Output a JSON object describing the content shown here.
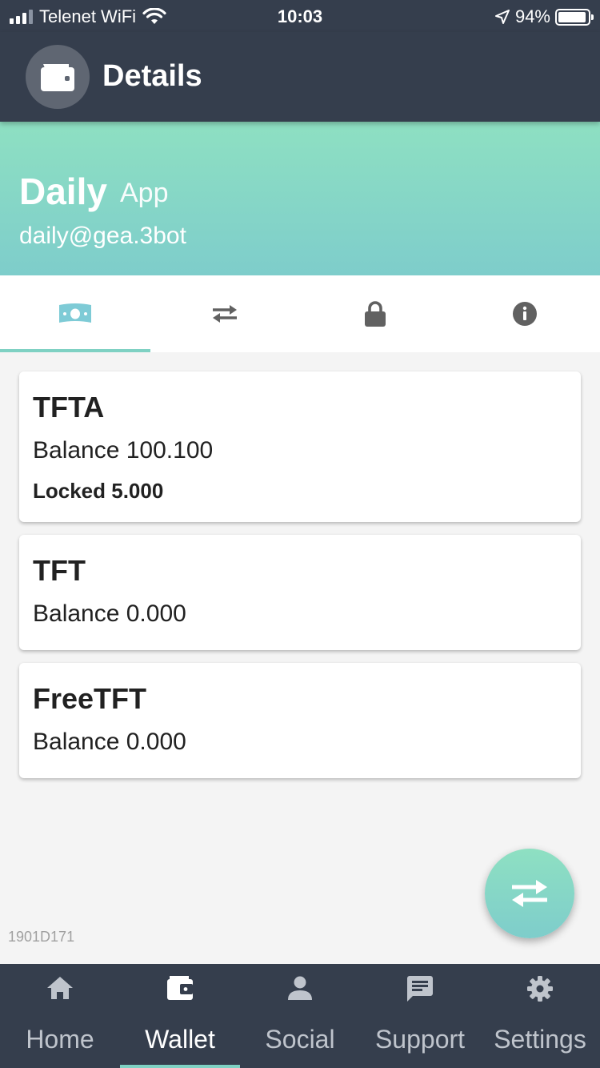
{
  "status_bar": {
    "carrier": "Telenet WiFi",
    "time": "10:03",
    "battery": "94%",
    "battery_level": 0.94,
    "icons": [
      "signal-icon",
      "wifi-icon",
      "location-arrow-icon",
      "battery-icon"
    ]
  },
  "header": {
    "title": "Details",
    "icon": "wallet-icon"
  },
  "wallet": {
    "name": "Daily",
    "type": "App",
    "email": "daily@gea.3bot"
  },
  "tabs": [
    {
      "icon": "money-icon",
      "active": true
    },
    {
      "icon": "transfer-icon",
      "active": false
    },
    {
      "icon": "lock-icon",
      "active": false
    },
    {
      "icon": "info-icon",
      "active": false
    }
  ],
  "balances": [
    {
      "currency": "TFTA",
      "balance": "Balance 100.100",
      "locked": "Locked 5.000"
    },
    {
      "currency": "TFT",
      "balance": "Balance 0.000"
    },
    {
      "currency": "FreeTFT",
      "balance": "Balance 0.000"
    }
  ],
  "build_id": "1901D171",
  "fab": {
    "icon": "transfer-icon"
  },
  "bottom_nav": [
    {
      "label": "Home",
      "icon": "home-icon",
      "active": false
    },
    {
      "label": "Wallet",
      "icon": "wallet-icon",
      "active": true
    },
    {
      "label": "Social",
      "icon": "person-icon",
      "active": false
    },
    {
      "label": "Support",
      "icon": "chat-icon",
      "active": false
    },
    {
      "label": "Settings",
      "icon": "gear-icon",
      "active": false
    }
  ],
  "colors": {
    "dark": "#353e4d",
    "accent_start": "#8ee0c2",
    "accent_end": "#7ecdcb",
    "tab_icon_active": "#7ecbd6",
    "tab_icon_inactive": "#616161"
  }
}
